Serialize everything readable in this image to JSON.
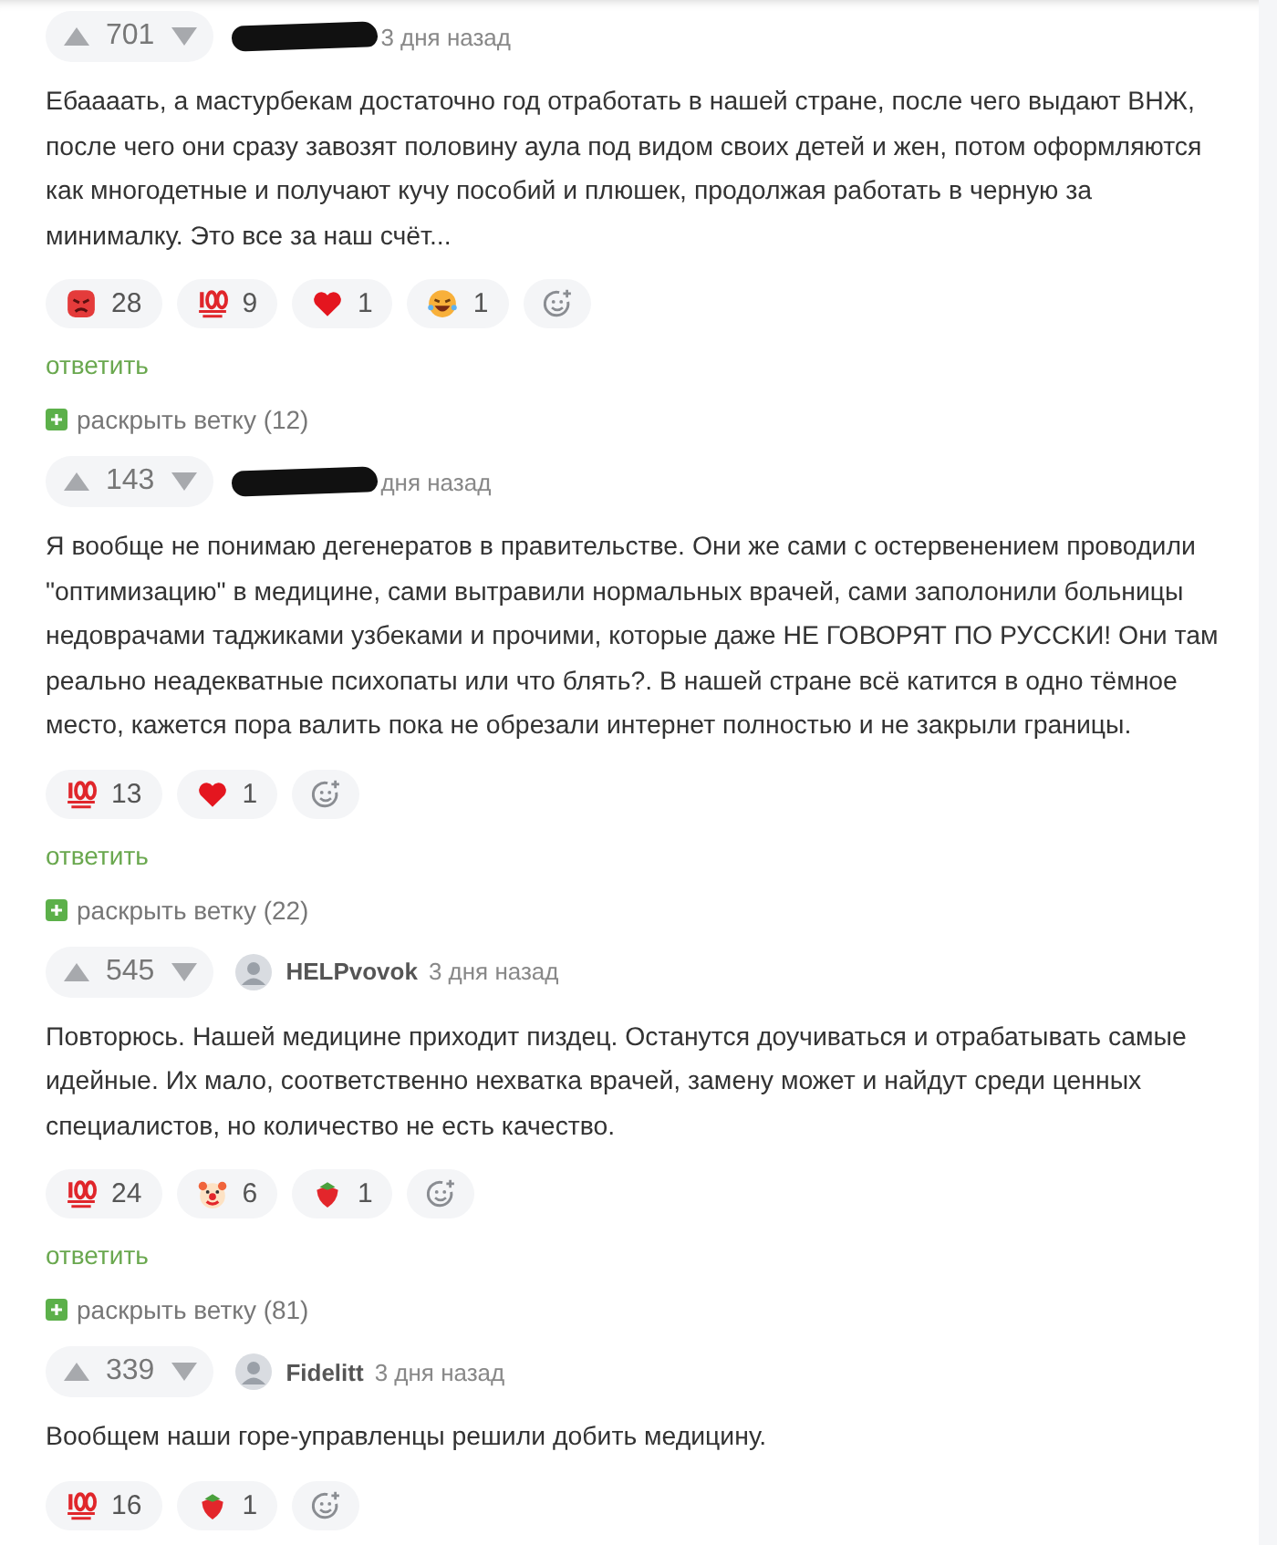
{
  "comments": [
    {
      "rating": "701",
      "author": {
        "kind": "hidden"
      },
      "time": "3 дня назад",
      "text": "Ебаааать, а мастурбекам достаточно год отработать в нашей стране, после чего выдают ВНЖ, после чего они сразу завозят половину аула под видом своих детей и жен, потом оформляются как многодетные и получают кучу пособий и плюшек, продолжая работать в черную за минималку. Это все за наш счёт...",
      "reactions": [
        {
          "kind": "angry",
          "count": "28"
        },
        {
          "kind": "hundred",
          "count": "9"
        },
        {
          "kind": "heart",
          "count": "1"
        },
        {
          "kind": "laugh",
          "count": "1"
        }
      ],
      "reply": "ответить",
      "expand": "раскрыть ветку (12)"
    },
    {
      "rating": "143",
      "author": {
        "kind": "hidden"
      },
      "time": "дня назад",
      "text": "Я вообще не понимаю дегенератов в правительстве. Они же сами с остервенением проводили \"оптимизацию\" в медицине, сами вытравили нормальных врачей, сами заполонили больницы недоврачами таджиками узбеками и прочими, которые даже НЕ ГОВОРЯТ ПО РУССКИ! Они там реально неадекватные психопаты или что блять?. В нашей стране всё катится в одно тёмное место, кажется пора валить пока не обрезали интернет полностью и не закрыли границы.",
      "reactions": [
        {
          "kind": "hundred",
          "count": "13"
        },
        {
          "kind": "heart",
          "count": "1"
        }
      ],
      "reply": "ответить",
      "expand": "раскрыть ветку (22)"
    },
    {
      "rating": "545",
      "author": {
        "kind": "user",
        "name": "HELPvovok"
      },
      "time": "3 дня назад",
      "text": "Повторюсь. Нашей медицине приходит пиздец. Останутся доучиваться и отрабатывать самые идейные. Их мало, соответственно нехватка врачей, замену может и найдут среди ценных специалистов, но количество не есть качество.",
      "reactions": [
        {
          "kind": "hundred",
          "count": "24"
        },
        {
          "kind": "clown",
          "count": "6"
        },
        {
          "kind": "strawberry",
          "count": "1"
        }
      ],
      "reply": "ответить",
      "expand": "раскрыть ветку (81)"
    },
    {
      "rating": "339",
      "author": {
        "kind": "user",
        "name": "Fidelitt"
      },
      "time": "3 дня назад",
      "text": "Вообщем наши горе-управленцы решили добить медицину.",
      "reactions": [
        {
          "kind": "hundred",
          "count": "16"
        },
        {
          "kind": "strawberry",
          "count": "1"
        }
      ]
    }
  ]
}
